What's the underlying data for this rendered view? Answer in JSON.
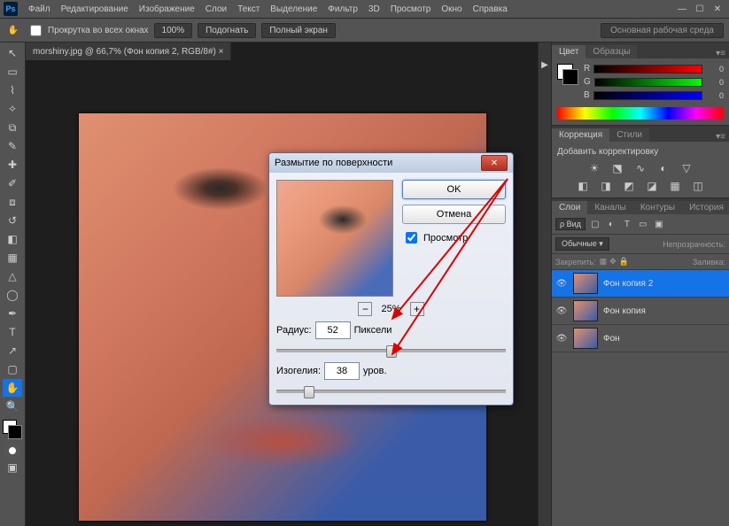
{
  "menu": {
    "file": "Файл",
    "edit": "Редактирование",
    "image": "Изображение",
    "layers": "Слои",
    "text": "Текст",
    "select": "Выделение",
    "filter": "Фильтр",
    "3d": "3D",
    "view": "Просмотр",
    "window": "Окно",
    "help": "Справка"
  },
  "options": {
    "scroll_all": "Прокрутка во всех окнах",
    "zoom": "100%",
    "fit": "Подогнать",
    "full": "Полный экран",
    "workspace": "Основная рабочая среда"
  },
  "doc_tab": "morshiny.jpg @ 66,7% (Фон копия 2, RGB/8#) ×",
  "color_panel": {
    "tab1": "Цвет",
    "tab2": "Образцы",
    "r": "R",
    "g": "G",
    "b": "B",
    "val": "0"
  },
  "corrections": {
    "tab1": "Коррекция",
    "tab2": "Стили",
    "add": "Добавить корректировку"
  },
  "layers_panel": {
    "tab1": "Слои",
    "tab2": "Каналы",
    "tab3": "Контуры",
    "tab4": "История",
    "kind": "ρ Вид",
    "blend": "Обычные",
    "opacity_lbl": "Непрозрачность:",
    "lock_lbl": "Закрепить:",
    "fill_lbl": "Заливка:",
    "layers": [
      {
        "name": "Фон копия 2",
        "sel": true
      },
      {
        "name": "Фон копия",
        "sel": false
      },
      {
        "name": "Фон",
        "sel": false
      }
    ]
  },
  "dialog": {
    "title": "Размытие по поверхности",
    "ok": "OK",
    "cancel": "Отмена",
    "preview": "Просмотр",
    "zoom": "25%",
    "radius_lbl": "Радиус:",
    "radius_val": "52",
    "radius_unit": "Пиксели",
    "threshold_lbl": "Изогелия:",
    "threshold_val": "38",
    "threshold_unit": "уров."
  }
}
